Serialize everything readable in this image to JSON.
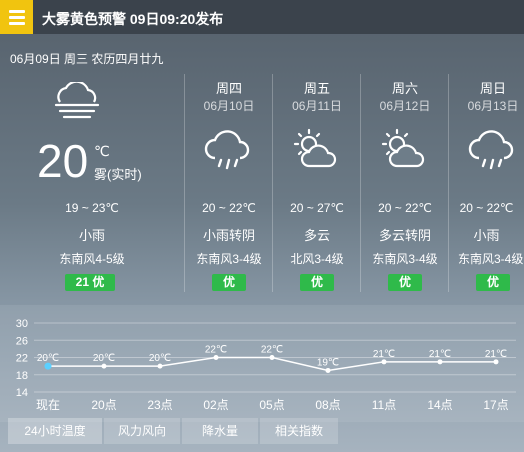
{
  "alert": {
    "text": "大雾黄色预警 09日09:20发布",
    "color": "#f1c40f",
    "icon": "menu-icon"
  },
  "header": {
    "date_line": "06月09日 周三 农历四月廿九"
  },
  "today": {
    "temp": "20",
    "unit": "℃",
    "realtime_cond": "雾(实时)",
    "range": "19 ~ 23℃",
    "weather": "小雨",
    "wind": "东南风4-5级",
    "aqi": "21 优",
    "icon": "fog-cloud-icon"
  },
  "forecast": [
    {
      "day": "周四",
      "date": "06月10日",
      "range": "20 ~ 22℃",
      "weather": "小雨转阴",
      "wind": "东南风3-4级",
      "aqi": "优",
      "icon": "rain-cloud-icon"
    },
    {
      "day": "周五",
      "date": "06月11日",
      "range": "20 ~ 27℃",
      "weather": "多云",
      "wind": "北风3-4级",
      "aqi": "优",
      "icon": "partly-cloudy-icon"
    },
    {
      "day": "周六",
      "date": "06月12日",
      "range": "20 ~ 22℃",
      "weather": "多云转阴",
      "wind": "东南风3-4级",
      "aqi": "优",
      "icon": "partly-cloudy-icon"
    },
    {
      "day": "周日",
      "date": "06月13日",
      "range": "20 ~ 22℃",
      "weather": "小雨",
      "wind": "东南风3-4级",
      "aqi": "优",
      "icon": "rain-cloud-icon"
    }
  ],
  "colors": {
    "aqi_good": "#2fba4a",
    "alert_bar": "#3b434c"
  },
  "chart_data": {
    "type": "line",
    "categories": [
      "现在",
      "20点",
      "23点",
      "02点",
      "05点",
      "08点",
      "11点",
      "14点",
      "17点"
    ],
    "values": [
      20,
      20,
      20,
      22,
      22,
      19,
      21,
      21,
      21
    ],
    "value_labels": [
      "20℃",
      "20℃",
      "20℃",
      "22℃",
      "22℃",
      "19℃",
      "21℃",
      "21℃",
      "21℃"
    ],
    "yticks": [
      "30",
      "26",
      "22",
      "18",
      "14"
    ],
    "ylim": [
      14,
      30
    ],
    "grid": true
  },
  "tabs": [
    "24小时温度",
    "风力风向",
    "降水量",
    "相关指数"
  ]
}
